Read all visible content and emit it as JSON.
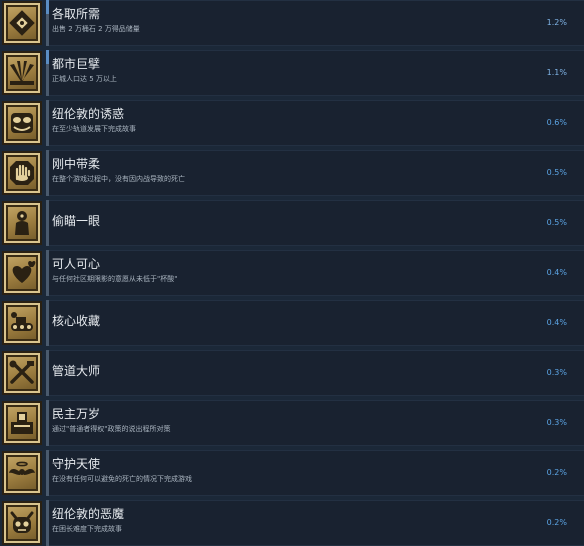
{
  "achievements": [
    {
      "title": "各取所需",
      "description": "出售 2 万桶石 2 万得品储量",
      "percent": "1.2%",
      "icon": "cube-emblem-icon",
      "progress": 0.3
    },
    {
      "title": "都市巨擘",
      "description": "正城人口达 5 万以上",
      "percent": "1.1%",
      "icon": "skyline-rays-icon",
      "progress": 0.3
    },
    {
      "title": "纽伦敦的诱惑",
      "description": "在至少轨道发展下完成故事",
      "percent": "0.6%",
      "icon": "mask-face-icon",
      "progress": 0
    },
    {
      "title": "刚中带柔",
      "description": "在整个游戏过程中，没有因内战导致的死亡",
      "percent": "0.5%",
      "icon": "hand-icon",
      "progress": 0
    },
    {
      "title": "偷瞄一眼",
      "description": "",
      "percent": "0.5%",
      "icon": "peeking-figure-icon",
      "progress": 0
    },
    {
      "title": "可人可心",
      "description": "与任何社区期限影的意愿从未低于\"杯酸\"",
      "percent": "0.4%",
      "icon": "hearts-icon",
      "progress": 0
    },
    {
      "title": "核心收藏",
      "description": "",
      "percent": "0.4%",
      "icon": "tank-machine-icon",
      "progress": 0
    },
    {
      "title": "管道大师",
      "description": "",
      "percent": "0.3%",
      "icon": "crossed-tools-icon",
      "progress": 0
    },
    {
      "title": "民主万岁",
      "description": "通过\"普通者得权\"政策的说出程所对策",
      "percent": "0.3%",
      "icon": "ballot-box-icon",
      "progress": 0
    },
    {
      "title": "守护天使",
      "description": "在没有任何可以避免的死亡的情况下完成游戏",
      "percent": "0.2%",
      "icon": "angel-wings-icon",
      "progress": 0
    },
    {
      "title": "纽伦敦的恶魔",
      "description": "在困长难度下完成故事",
      "percent": "0.2%",
      "icon": "demon-skull-icon",
      "progress": 0
    }
  ]
}
